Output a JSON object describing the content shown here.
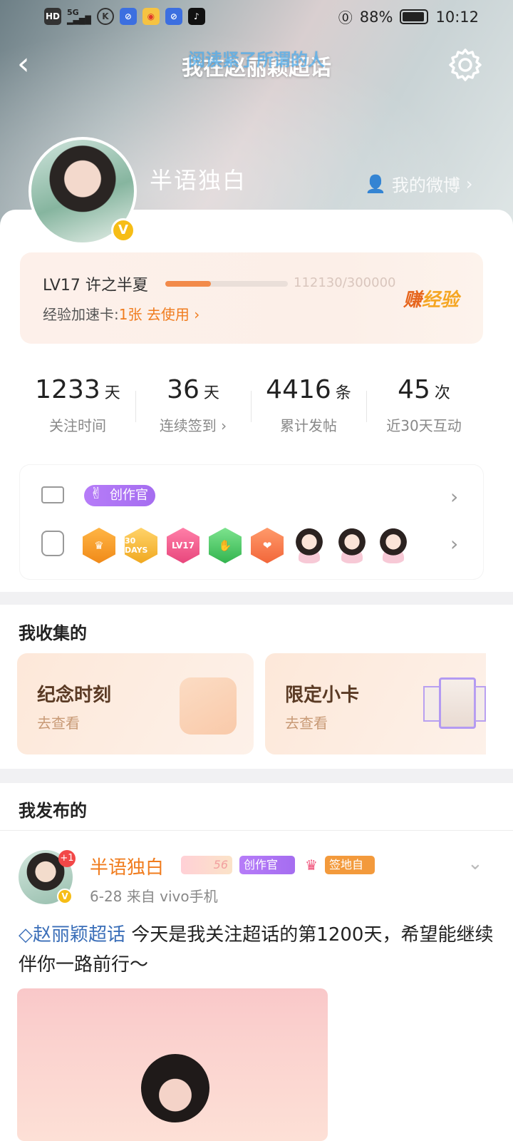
{
  "status_bar": {
    "left_icons": [
      "hd-icon",
      "5g-signal-icon",
      "k-app-icon",
      "browser-icon",
      "weibo-icon",
      "browser-icon",
      "tiktok-icon"
    ],
    "hd": "HD",
    "network": "5G",
    "battery": "88%",
    "time": "10:12"
  },
  "nav": {
    "title": "我在赵丽颖超话",
    "ghost_text": "阅读紧了所谓的人"
  },
  "profile": {
    "name": "半语独白",
    "my_weibo": "我的微博"
  },
  "level": {
    "label": "LV17 许之半夏",
    "progress": 0.374,
    "numbers": "112130/300000",
    "speed_prefix": "经验加速卡:",
    "speed_value": "1张 去使用",
    "earn_a": "赚",
    "earn_b": "经验"
  },
  "stats": [
    {
      "num": "1233",
      "unit": "天",
      "label": "关注时间"
    },
    {
      "num": "36",
      "unit": "天",
      "label": "连续签到"
    },
    {
      "num": "4416",
      "unit": "条",
      "label": "累计发帖"
    },
    {
      "num": "45",
      "unit": "次",
      "label": "近30天互动"
    }
  ],
  "badges": {
    "creator": "创作官",
    "medal_labels": [
      "",
      "30 DAYS",
      "LV17",
      "",
      "",
      ""
    ]
  },
  "collected": {
    "title": "我收集的",
    "cards": [
      {
        "title": "纪念时刻",
        "sub": "去查看"
      },
      {
        "title": "限定小卡",
        "sub": "去查看"
      }
    ]
  },
  "posts": {
    "title": "我发布的",
    "item": {
      "name": "半语独白",
      "plus": "+1",
      "level_tag": "56",
      "creator_tag": "创作官",
      "tag3": "签地自萌",
      "meta": "6-28  来自 vivo手机",
      "topic": "赵丽颖超话",
      "text": " 今天是我关注超话的第1200天，希望能继续伴你一路前行～"
    }
  },
  "colors": {
    "accent": "#f07c1e",
    "creator_purple": "#a56df0",
    "vip_gold": "#f6bd16"
  }
}
